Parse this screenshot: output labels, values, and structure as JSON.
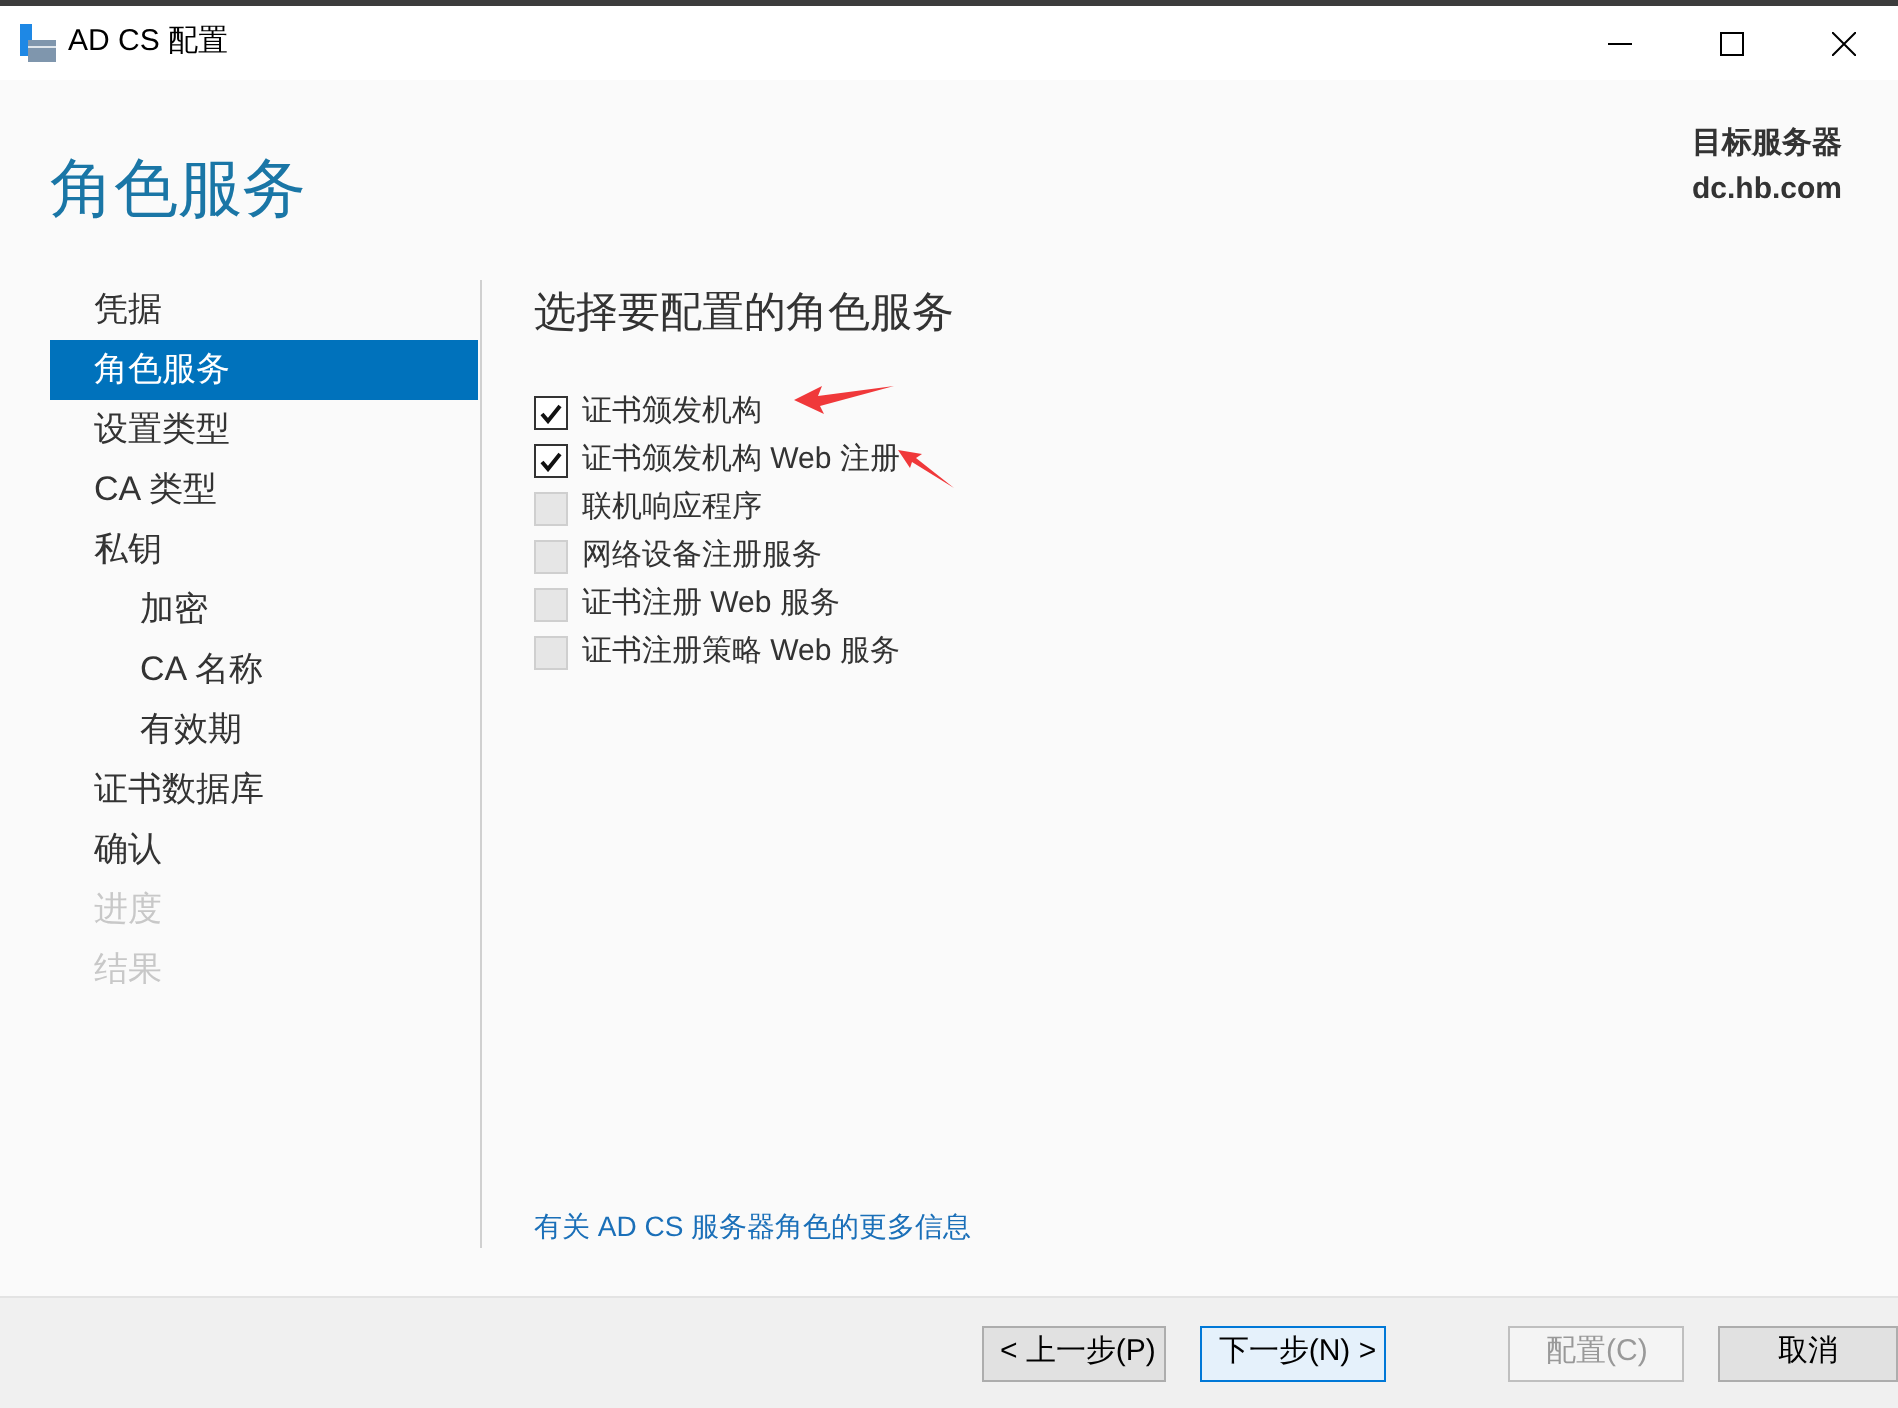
{
  "window": {
    "title": "AD CS 配置"
  },
  "page_title": "角色服务",
  "target_server": {
    "label": "目标服务器",
    "name": "dc.hb.com"
  },
  "sidebar": {
    "items": [
      {
        "label": "凭据",
        "selected": false,
        "disabled": false
      },
      {
        "label": "角色服务",
        "selected": true,
        "disabled": false
      },
      {
        "label": "设置类型",
        "selected": false,
        "disabled": false
      },
      {
        "label": "CA 类型",
        "selected": false,
        "disabled": false
      },
      {
        "label": "私钥",
        "selected": false,
        "disabled": false,
        "children": [
          {
            "label": "加密",
            "selected": false,
            "disabled": false
          },
          {
            "label": "CA 名称",
            "selected": false,
            "disabled": false
          },
          {
            "label": "有效期",
            "selected": false,
            "disabled": false
          }
        ]
      },
      {
        "label": "证书数据库",
        "selected": false,
        "disabled": false
      },
      {
        "label": "确认",
        "selected": false,
        "disabled": false
      },
      {
        "label": "进度",
        "selected": false,
        "disabled": true
      },
      {
        "label": "结果",
        "selected": false,
        "disabled": true
      }
    ]
  },
  "content": {
    "heading": "选择要配置的角色服务",
    "roles": [
      {
        "label": "证书颁发机构",
        "checked": true,
        "annotated": true
      },
      {
        "label": "证书颁发机构 Web 注册",
        "checked": true,
        "annotated": true
      },
      {
        "label": "联机响应程序",
        "checked": false,
        "annotated": false
      },
      {
        "label": "网络设备注册服务",
        "checked": false,
        "annotated": false
      },
      {
        "label": "证书注册 Web 服务",
        "checked": false,
        "annotated": false
      },
      {
        "label": "证书注册策略 Web 服务",
        "checked": false,
        "annotated": false
      }
    ],
    "more_info_link": "有关 AD CS 服务器角色的更多信息"
  },
  "buttons": [
    {
      "label": "< 上一步(P)",
      "disabled": false,
      "default": false
    },
    {
      "label": "下一步(N) >",
      "disabled": false,
      "default": true
    },
    {
      "label": "配置(C)",
      "disabled": true,
      "default": false
    },
    {
      "label": "取消",
      "disabled": false,
      "default": false
    }
  ]
}
